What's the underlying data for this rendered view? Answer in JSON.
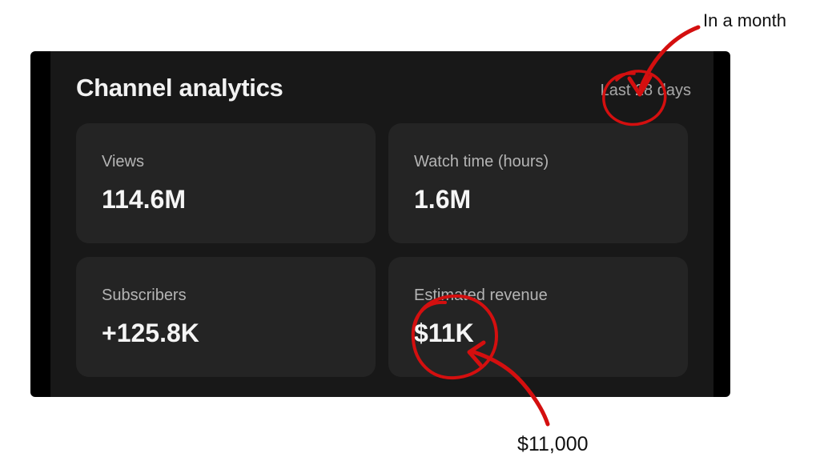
{
  "analytics": {
    "title": "Channel analytics",
    "period": "Last 28 days",
    "cards": [
      {
        "label": "Views",
        "value": "114.6M"
      },
      {
        "label": "Watch time (hours)",
        "value": "1.6M"
      },
      {
        "label": "Subscribers",
        "value": "+125.8K"
      },
      {
        "label": "Estimated revenue",
        "value": "$11K"
      }
    ]
  },
  "annotations": {
    "period_note": "In a month",
    "revenue_note": "$11,000",
    "color": "#d40f0f"
  },
  "colors": {
    "background": "#000000",
    "panel": "#181818",
    "card": "#242424",
    "title_text": "#f2f2f2",
    "muted_text": "#b4b4b4"
  }
}
